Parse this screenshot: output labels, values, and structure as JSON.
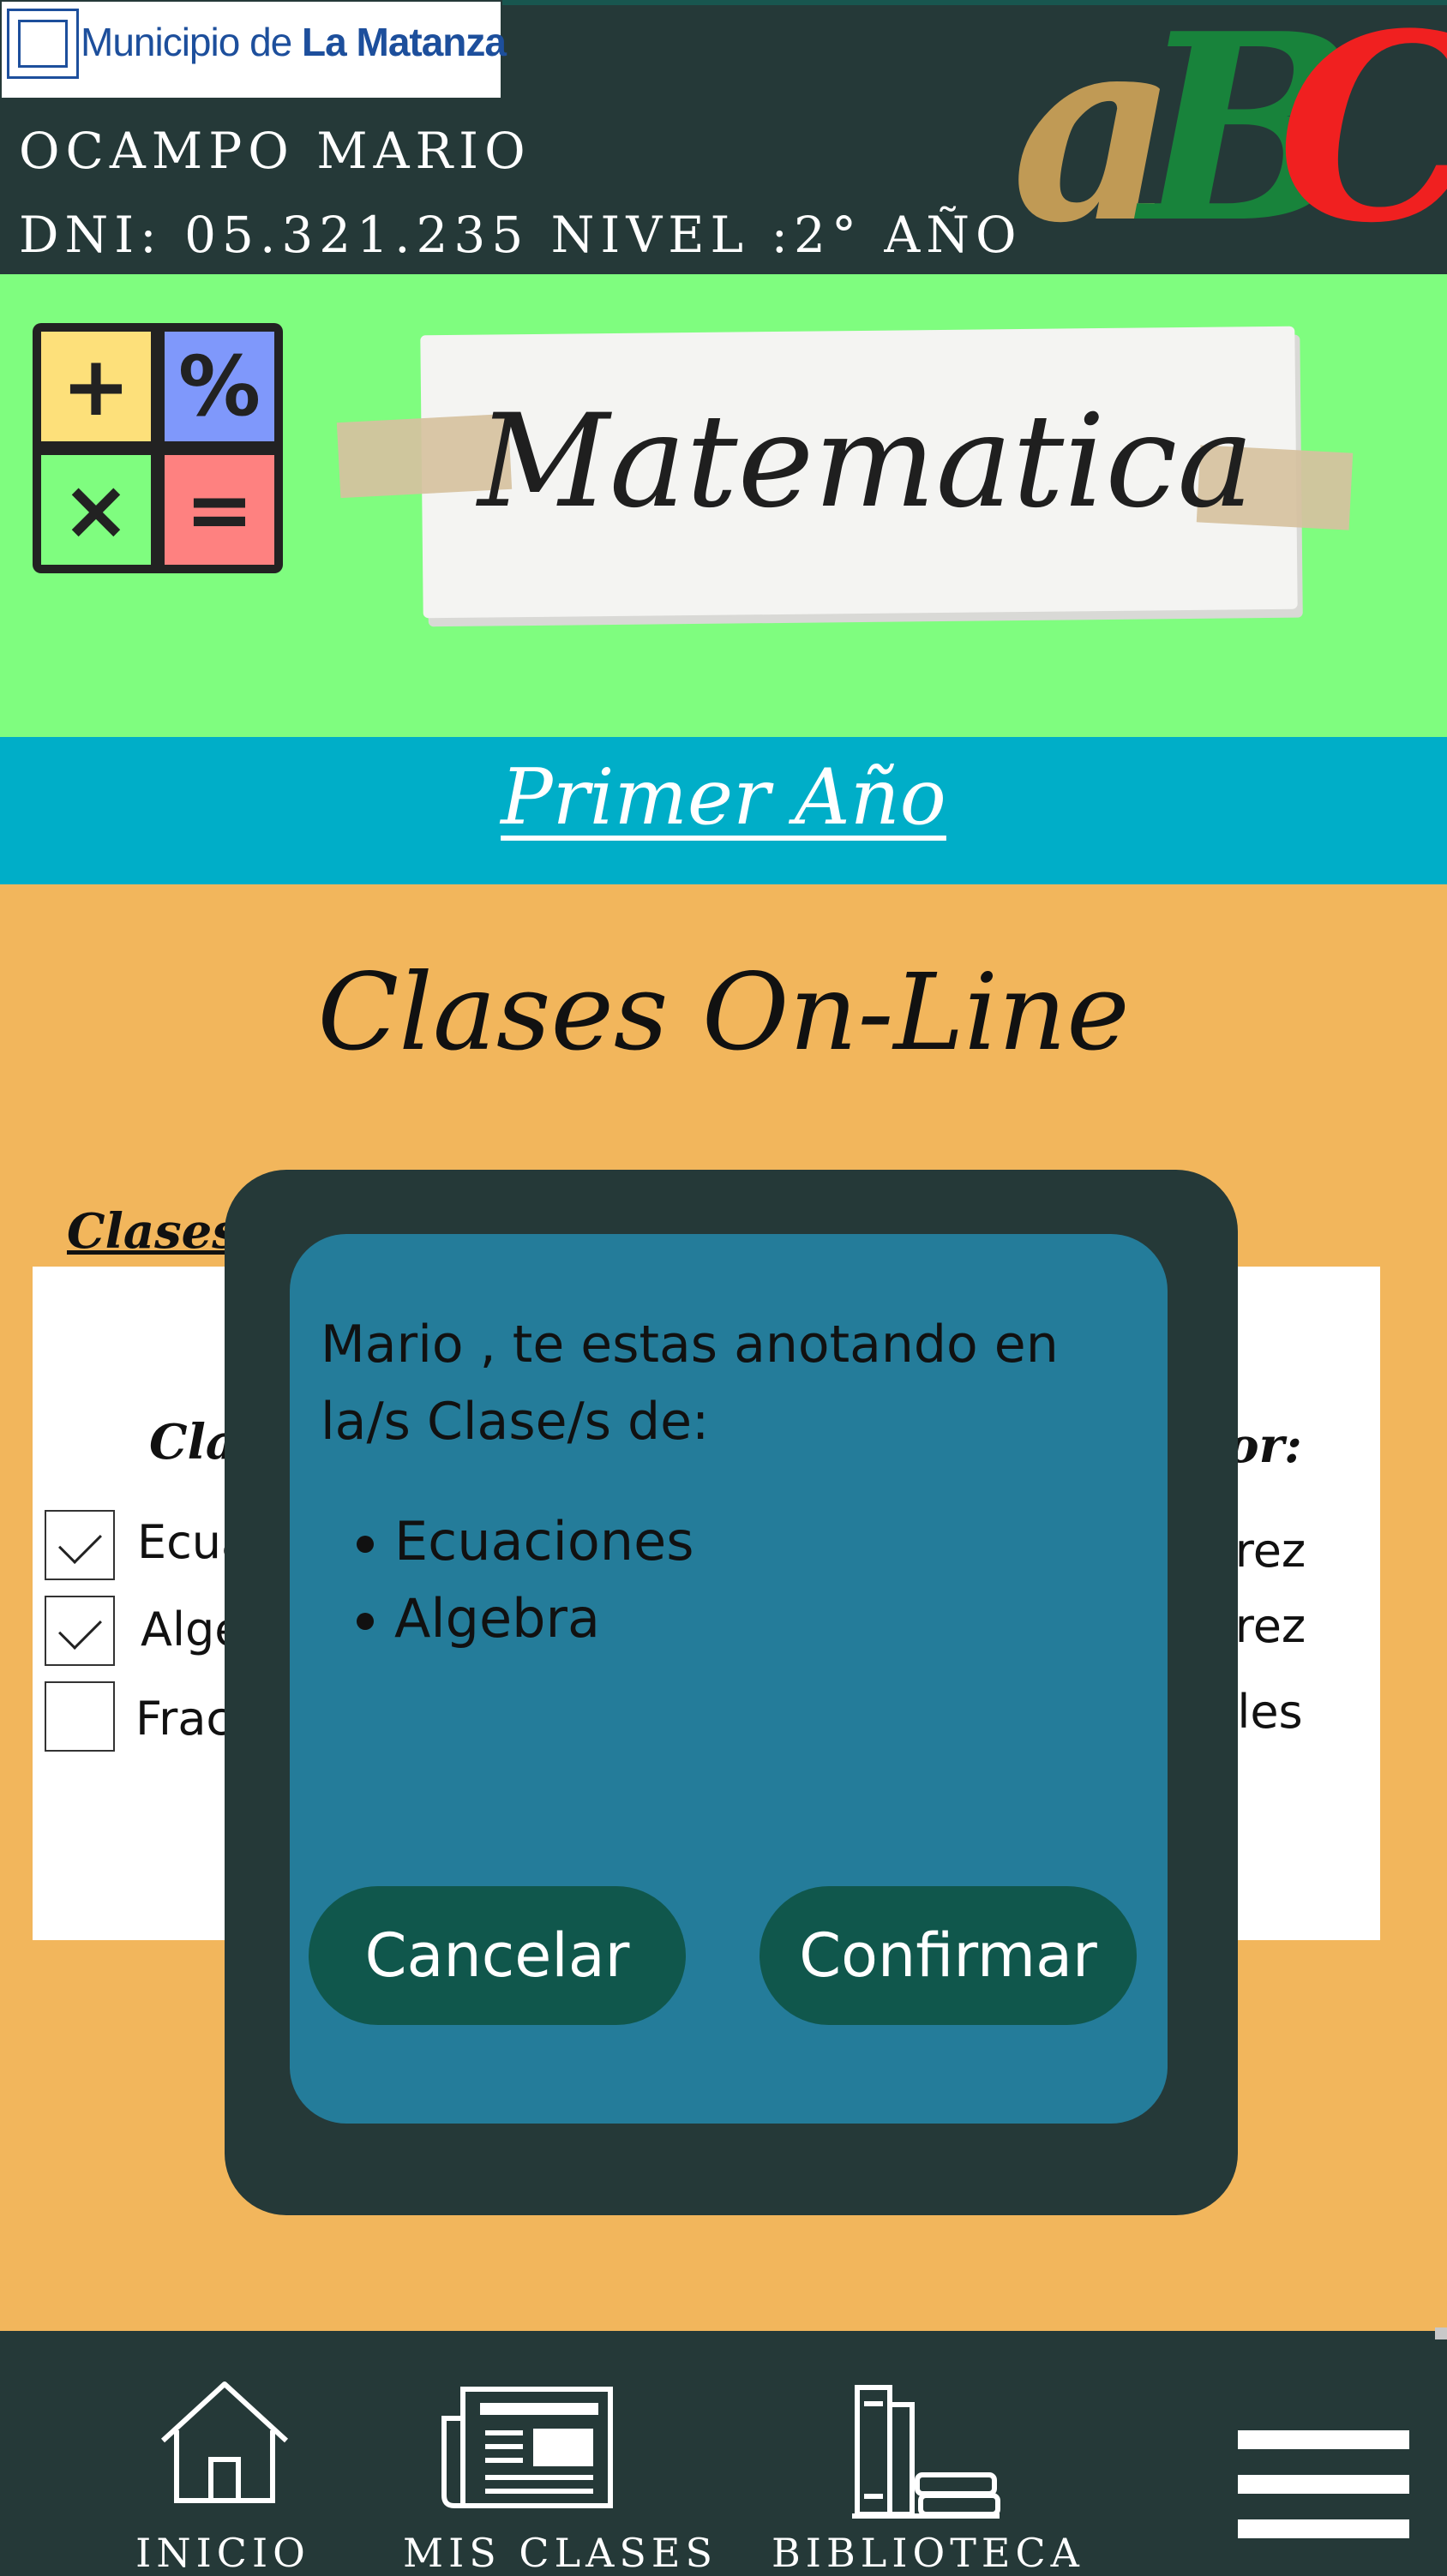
{
  "header": {
    "logo": {
      "text_regular": "Municipio de",
      "text_bold": "La Matanza"
    },
    "user_name": "OCAMPO MARIO",
    "user_info": "DNI: 05.321.235 NIVEL :2° AÑO",
    "brand_letters": [
      "a",
      "B",
      "C"
    ],
    "brand_colors": [
      "#c09a55",
      "#18833b",
      "#f02020"
    ]
  },
  "subject": {
    "icon_symbols": [
      "+",
      "%",
      "×",
      "="
    ],
    "icon_colors": [
      "#fde07a",
      "#7f98fb",
      "#7ffd7f",
      "#fe8180"
    ],
    "title": "Matematica"
  },
  "year": {
    "label": "Primer Año"
  },
  "content": {
    "title": "Clases On-Line",
    "available_label": "Clases Disponibles:",
    "table": {
      "col_class_header": "Clase",
      "col_teacher_header": "fesor:",
      "rows": [
        {
          "class": "Ecuacio",
          "teacher": "amirez",
          "checked": true
        },
        {
          "class": "Algebra",
          "teacher": "amirez",
          "checked": true
        },
        {
          "class": "Fraccio",
          "teacher": "lorales",
          "checked": false
        }
      ]
    }
  },
  "modal": {
    "message": "Mario , te estas anotando en la/s Clase/s de:",
    "items": [
      "Ecuaciones",
      "Algebra"
    ],
    "cancel_label": "Cancelar",
    "confirm_label": "Confirmar"
  },
  "nav": {
    "items": [
      {
        "label": "INICIO",
        "icon": "home-icon"
      },
      {
        "label": "MIS CLASES",
        "icon": "newspaper-icon"
      },
      {
        "label": "BIBLIOTECA",
        "icon": "books-icon"
      }
    ],
    "menu_icon": "hamburger-menu-icon"
  },
  "colors": {
    "dark": "#253938",
    "green_banner": "#7ffd7f",
    "cyan_bar": "#00aec8",
    "orange_content": "#f2b65c",
    "modal_blue": "#247c9a",
    "button_green": "#10574c"
  }
}
